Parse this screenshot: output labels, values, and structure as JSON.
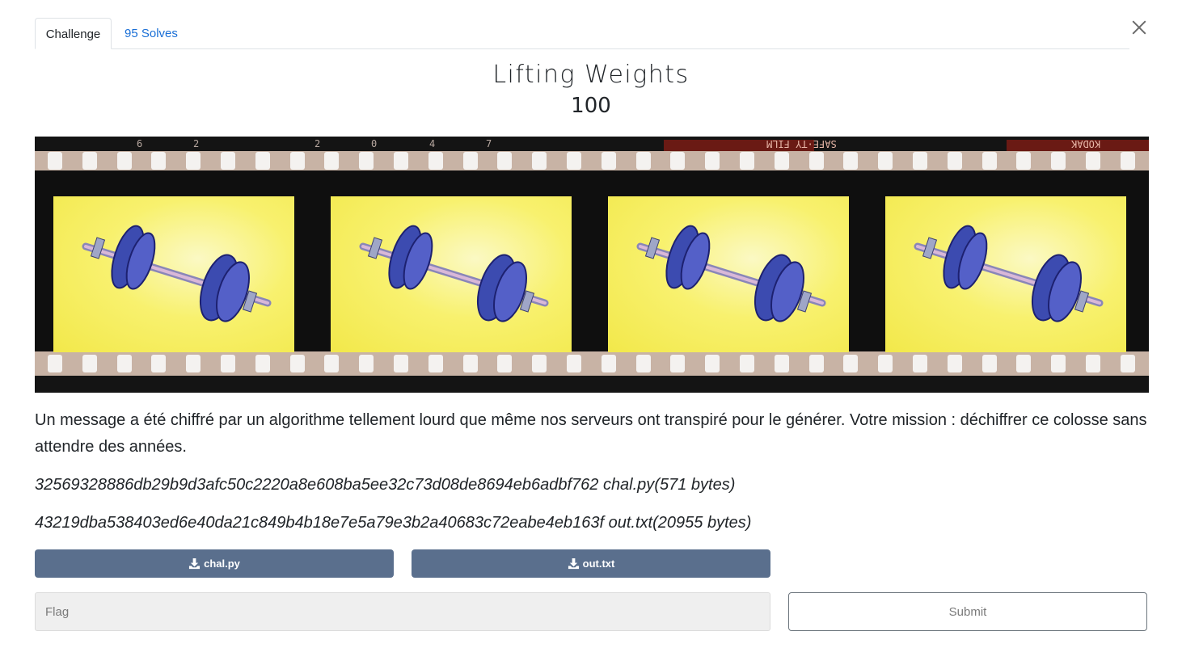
{
  "tabs": [
    {
      "label": "Challenge",
      "active": true
    },
    {
      "label": "95 Solves",
      "active": false
    }
  ],
  "challenge": {
    "title": "Lifting Weights",
    "points": "100",
    "image": {
      "film_marks": [
        "6",
        "2",
        "2",
        "0",
        "4",
        "7"
      ],
      "film_brand_text": "KODAK",
      "film_safety_text": "SAFE·TY FILM",
      "subject": "dumbbell-illustration",
      "frame_count": 4,
      "frame_background_color": "#f8f16e",
      "weight_plate_color": "#3c4bb0"
    },
    "description": "Un message a été chiffré par un algorithme tellement lourd que même nos serveurs ont transpiré pour le générer. Votre mission : déchiffrer ce colosse sans attendre des années.",
    "files": [
      {
        "hash": "32569328886db29b9d3afc50c2220a8e608ba5ee32c73d08de8694eb6adbf762",
        "name": "chal.py",
        "size": "(571 bytes)"
      },
      {
        "hash": "43219dba538403ed6e40da21c849b4b18e7e5a79e3b2a40683c72eabe4eb163f",
        "name": "out.txt",
        "size": "(20955 bytes)"
      }
    ],
    "downloads": [
      {
        "label": "chal.py",
        "icon": "download-icon"
      },
      {
        "label": "out.txt",
        "icon": "download-icon"
      }
    ]
  },
  "form": {
    "flag_placeholder": "Flag",
    "flag_value": "",
    "submit_label": "Submit"
  },
  "colors": {
    "link": "#1a6fd6",
    "download_button": "#5a6f8d"
  }
}
